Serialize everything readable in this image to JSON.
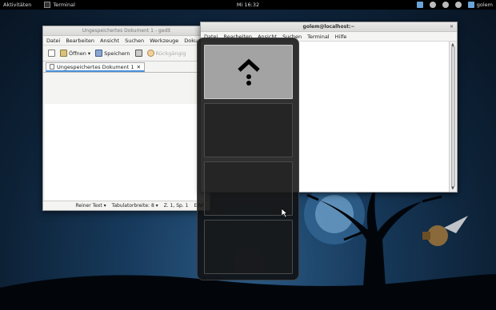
{
  "topbar": {
    "activities": "Aktivitäten",
    "app_name": "Terminal",
    "clock": "Mi 16:32",
    "user": "golem"
  },
  "gedit": {
    "title": "Ungespeichertes Dokument 1 - gedit",
    "menu": [
      "Datei",
      "Bearbeiten",
      "Ansicht",
      "Suchen",
      "Werkzeuge",
      "Dokume"
    ],
    "toolbar": {
      "open": "Öffnen",
      "save": "Speichern",
      "undo": "Rückgängig"
    },
    "tab_label": "Ungespeichertes Dokument 1",
    "status": {
      "mode": "Reiner Text",
      "tabwidth": "Tabulatorbreite: 8",
      "position": "Z. 1, Sp. 1",
      "insert": "EINF"
    }
  },
  "terminal": {
    "title": "golem@localhost:~",
    "menu": [
      "Datei",
      "Bearbeiten",
      "Ansicht",
      "Suchen",
      "Terminal",
      "Hilfe"
    ]
  },
  "workspaces": {
    "active_index": 0,
    "count": 4
  },
  "colors": {
    "desktop": "#0d2136",
    "accent": "#4a90d9"
  }
}
